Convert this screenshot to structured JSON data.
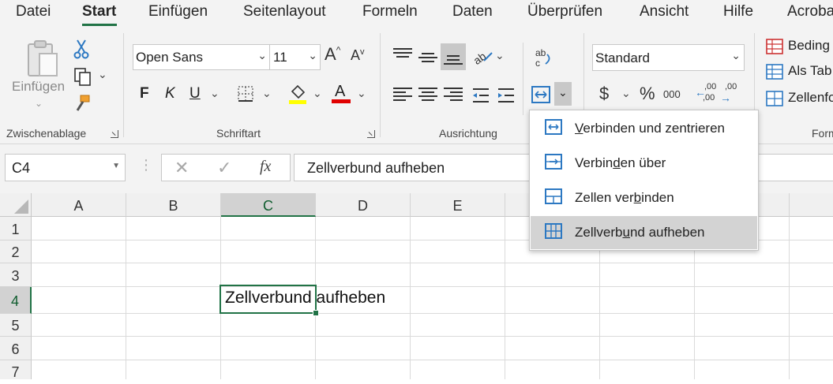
{
  "menu": {
    "tabs": [
      "Datei",
      "Start",
      "Einfügen",
      "Seitenlayout",
      "Formeln",
      "Daten",
      "Überprüfen",
      "Ansicht",
      "Hilfe",
      "Acroba"
    ],
    "active": "Start"
  },
  "ribbon": {
    "clipboard": {
      "paste_label": "Einfügen",
      "group_label": "Zwischenablage"
    },
    "font": {
      "font_name": "Open Sans",
      "font_size": "11",
      "bold": "F",
      "italic": "K",
      "underline": "U",
      "group_label": "Schriftart",
      "highlight_color": "#ffff00",
      "font_color": "#e00000"
    },
    "alignment": {
      "group_label": "Ausrichtung"
    },
    "number": {
      "format": "Standard",
      "currency": "$",
      "percent": "%",
      "thousands": "000",
      "inc_decimal": ",00",
      "dec_decimal": ",00"
    },
    "styles": {
      "items": [
        "Beding",
        "Als Tab",
        "Zellenfo"
      ],
      "group_label": "Form"
    }
  },
  "formula_bar": {
    "name_box": "C4",
    "fx": "fx",
    "content": "Zellverbund aufheben"
  },
  "grid": {
    "columns": [
      "A",
      "B",
      "C",
      "D",
      "E"
    ],
    "rows": [
      "1",
      "2",
      "3",
      "4",
      "5",
      "6",
      "7"
    ],
    "active_cell": "C4",
    "cell_C4": "Zellverbund aufheben"
  },
  "merge_menu": {
    "items": [
      {
        "pre": "",
        "u": "V",
        "post": "erbinden und zentrieren"
      },
      {
        "pre": "Verbin",
        "u": "d",
        "post": "en über"
      },
      {
        "pre": "Zellen ver",
        "u": "b",
        "post": "inden"
      },
      {
        "pre": "Zellverb",
        "u": "u",
        "post": "nd aufheben"
      }
    ],
    "hover_index": 3
  },
  "colors": {
    "accent": "#217346",
    "icon_blue": "#2c78c2"
  }
}
